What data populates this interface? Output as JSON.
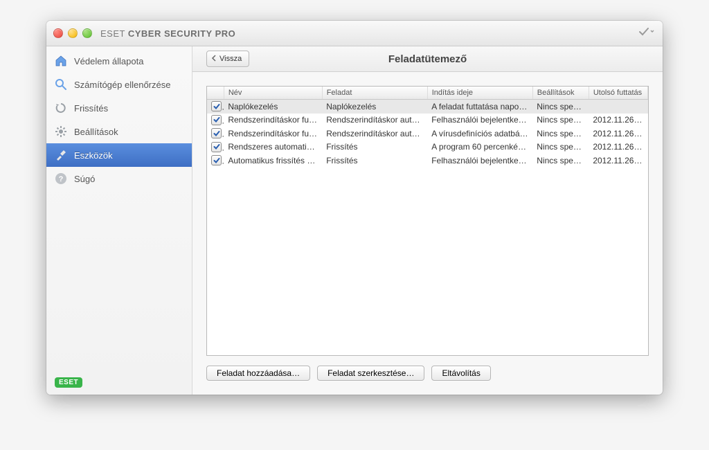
{
  "window": {
    "app_title_light": "ESET ",
    "app_title_bold": "CYBER SECURITY PRO"
  },
  "sidebar": {
    "items": [
      {
        "label": "Védelem állapota"
      },
      {
        "label": "Számítógép ellenőrzése"
      },
      {
        "label": "Frissítés"
      },
      {
        "label": "Beállítások"
      },
      {
        "label": "Eszközök"
      },
      {
        "label": "Súgó"
      }
    ],
    "footer_brand": "ESET"
  },
  "header": {
    "back_label": "Vissza",
    "panel_title": "Feladatütemező"
  },
  "table": {
    "columns": {
      "name": "Név",
      "task": "Feladat",
      "start": "Indítás ideje",
      "settings": "Beállítások",
      "last": "Utolsó futtatás"
    },
    "rows": [
      {
        "checked": true,
        "name": "Naplókezelés",
        "task": "Naplókezelés",
        "start": "A feladat futtatása napo…",
        "settings": "Nincs speci…",
        "last": "",
        "selected": true
      },
      {
        "checked": true,
        "name": "Rendszerindításkor fut…",
        "task": "Rendszerindításkor auto…",
        "start": "Felhasználói bejelentkez…",
        "settings": "Nincs speci…",
        "last": "2012.11.26.…"
      },
      {
        "checked": true,
        "name": "Rendszerindításkor fut…",
        "task": "Rendszerindításkor auto…",
        "start": "A vírusdefiníciós adatbá…",
        "settings": "Nincs speci…",
        "last": "2012.11.26.…"
      },
      {
        "checked": true,
        "name": "Rendszeres automatik…",
        "task": "Frissítés",
        "start": "A program 60 percenkén…",
        "settings": "Nincs speci…",
        "last": "2012.11.26.…"
      },
      {
        "checked": true,
        "name": "Automatikus frissítés a…",
        "task": "Frissítés",
        "start": "Felhasználói bejelentkez…",
        "settings": "Nincs speci…",
        "last": "2012.11.26.…"
      }
    ]
  },
  "buttons": {
    "add": "Feladat hozzáadása…",
    "edit": "Feladat szerkesztése…",
    "remove": "Eltávolítás"
  },
  "icons": {
    "home": "home",
    "search": "search",
    "refresh": "refresh",
    "gear": "gear",
    "tools": "tools",
    "help": "help",
    "check": "check",
    "chevron_left": "chevron-left",
    "dropdown": "dropdown"
  },
  "colors": {
    "accent": "#4a7dd0",
    "brand_green": "#39b44a"
  }
}
